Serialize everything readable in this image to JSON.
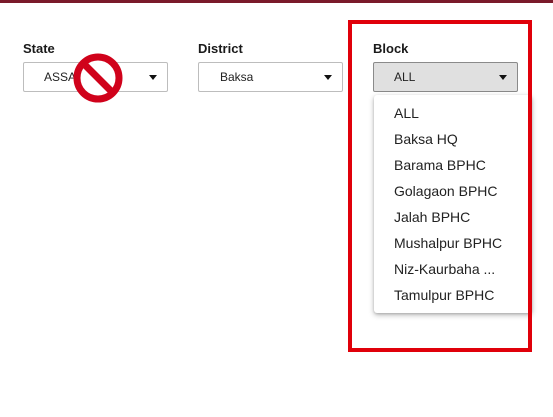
{
  "filters": {
    "state": {
      "label": "State",
      "value": "ASSAM"
    },
    "district": {
      "label": "District",
      "value": "Baksa"
    },
    "block": {
      "label": "Block",
      "value": "ALL",
      "options": [
        "ALL",
        "Baksa HQ",
        "Barama BPHC",
        "Golagaon BPHC",
        "Jalah BPHC",
        "Mushalpur BPHC",
        "Niz-Kaurbaha ...",
        "Tamulpur BPHC"
      ]
    }
  },
  "colors": {
    "top_bar": "#7a1a2a",
    "highlight_border": "#e0000a",
    "no_symbol": "#d0021b"
  },
  "icons": {
    "blocked": "no-entry-icon",
    "dropdown": "caret-down-icon"
  }
}
